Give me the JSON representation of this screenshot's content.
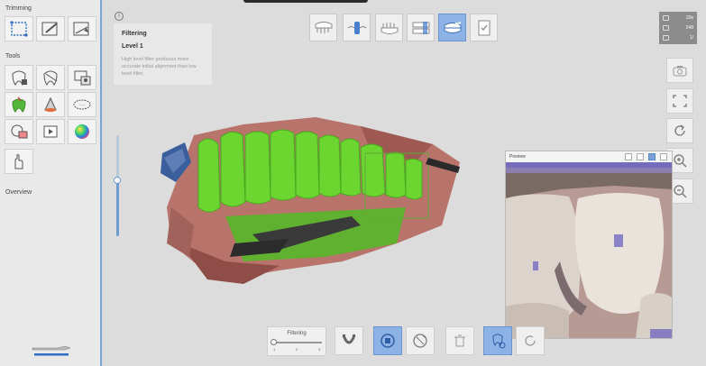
{
  "sidebar": {
    "trimming_title": "Trimming",
    "tools_title": "Tools",
    "overview_title": "Overview",
    "trimming_tools": [
      {
        "icon": "selection-box-icon"
      },
      {
        "icon": "brush-trim-icon"
      },
      {
        "icon": "cut-plane-icon"
      }
    ],
    "tools": [
      {
        "icon": "tooth-lock-icon"
      },
      {
        "icon": "tooth-outline-icon"
      },
      {
        "icon": "scan-area-icon"
      },
      {
        "icon": "green-tooth-icon"
      },
      {
        "icon": "cone-icon"
      },
      {
        "icon": "margin-line-icon"
      },
      {
        "icon": "compare-icon"
      },
      {
        "icon": "play-video-icon"
      },
      {
        "icon": "color-wheel-icon"
      },
      {
        "icon": "hand-icon"
      }
    ]
  },
  "steps": [
    {
      "icon": "upper-jaw-icon",
      "active": false
    },
    {
      "icon": "scan-body-icon",
      "active": false
    },
    {
      "icon": "lower-jaw-icon",
      "active": false
    },
    {
      "icon": "bite-icon",
      "active": false
    },
    {
      "icon": "occlusion-icon",
      "active": true
    },
    {
      "icon": "checklist-icon",
      "active": false
    }
  ],
  "info": {
    "icon_label": "i",
    "title": "Filtering",
    "level": "Level 1",
    "description": "High level filter produces more accurate initial alignment than low level filter."
  },
  "stats": [
    {
      "value": "20s"
    },
    {
      "value": "248"
    },
    {
      "value": "1/"
    }
  ],
  "right_buttons": [
    {
      "icon": "camera-icon"
    },
    {
      "icon": "fit-screen-icon"
    },
    {
      "icon": "rotate-icon"
    },
    {
      "icon": "zoom-in-icon"
    },
    {
      "icon": "zoom-out-icon"
    }
  ],
  "preview": {
    "title": "Preview"
  },
  "bottom": {
    "filtering_label": "Filtering",
    "ticks": [
      "1",
      "2",
      "3"
    ],
    "filter_level": 1,
    "buttons": [
      {
        "icon": "jaw-arch-icon",
        "active": false
      },
      {
        "icon": "stop-icon",
        "active": true
      },
      {
        "icon": "ai-scan-icon",
        "active": false
      },
      {
        "icon": "trash-icon",
        "active": false
      },
      {
        "icon": "lasso-tooth-icon",
        "active": true
      },
      {
        "icon": "reset-icon",
        "active": false
      }
    ]
  },
  "colors": {
    "accent": "#8db3e6",
    "scan_highlight": "#6cd631",
    "gum": "#b8746b"
  }
}
